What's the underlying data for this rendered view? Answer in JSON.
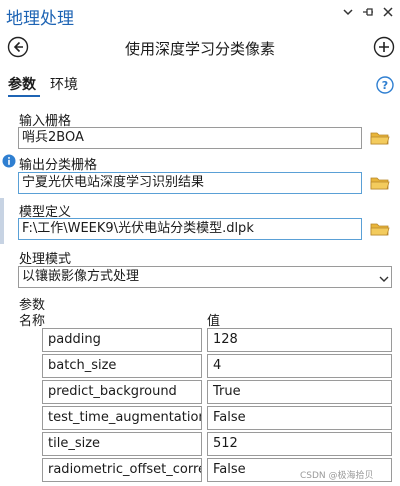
{
  "pane": {
    "title": "地理处理",
    "controls": [
      "chevron-down-icon",
      "pin-icon",
      "close-icon"
    ]
  },
  "tool": {
    "title": "使用深度学习分类像素"
  },
  "tabs": [
    {
      "label": "参数",
      "active": true
    },
    {
      "label": "环境",
      "active": false
    }
  ],
  "fields": {
    "input_raster": {
      "label": "输入栅格",
      "value": "哨兵2BOA"
    },
    "output_raster": {
      "label": "输出分类栅格",
      "value": "宁夏光伏电站深度学习识别结果"
    },
    "model_definition": {
      "label": "模型定义",
      "value": "F:\\工作\\WEEK9\\光伏电站分类模型.dlpk"
    },
    "processing_mode": {
      "label": "处理模式",
      "value": "以镶嵌影像方式处理"
    }
  },
  "arguments": {
    "section_label": "参数",
    "name_header": "名称",
    "value_header": "值",
    "rows": [
      {
        "name": "padding",
        "value": "128"
      },
      {
        "name": "batch_size",
        "value": "4"
      },
      {
        "name": "predict_background",
        "value": "True"
      },
      {
        "name": "test_time_augmentation",
        "value": "False"
      },
      {
        "name": "tile_size",
        "value": "512"
      },
      {
        "name": "radiometric_offset_correction",
        "value": "False"
      }
    ]
  },
  "watermark": "CSDN @极海拾贝",
  "colors": {
    "accent": "#1e64b4",
    "folder": "#e8b53a",
    "info": "#2f7fd1"
  }
}
